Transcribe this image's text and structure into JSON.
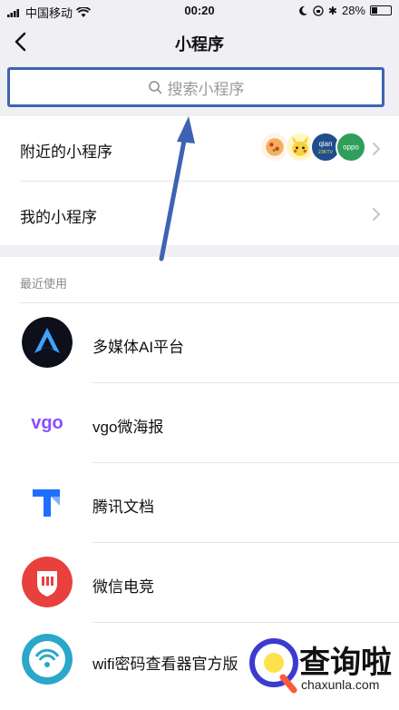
{
  "status_bar": {
    "carrier": "中国移动",
    "time": "00:20",
    "battery": "28%",
    "battery_level": 0.28
  },
  "nav": {
    "title": "小程序"
  },
  "search": {
    "placeholder": "搜索小程序"
  },
  "menu": {
    "nearby_label": "附近的小程序",
    "nearby_badges": [
      "pizza",
      "pikachu",
      "qian 23KTV",
      "oppo"
    ],
    "mine_label": "我的小程序"
  },
  "recent": {
    "header": "最近使用",
    "apps": [
      {
        "name": "多媒体AI平台",
        "icon": "ai-platform-icon",
        "color": "#1f2a44"
      },
      {
        "name": "vgo微海报",
        "icon": "vgo-icon",
        "color": "#8a4fff"
      },
      {
        "name": "腾讯文档",
        "icon": "tencent-docs-icon",
        "color": "#1e6fff"
      },
      {
        "name": "微信电竞",
        "icon": "wechat-esports-icon",
        "color": "#e8403c"
      },
      {
        "name": "wifi密码查看器官方版",
        "icon": "wifi-viewer-icon",
        "color": "#2aa7c9"
      }
    ]
  },
  "watermark": {
    "text": "查询啦",
    "url": "chaxunla.com"
  },
  "colors": {
    "accent_blue": "#3d63b2",
    "background_gray": "#efeff4"
  }
}
